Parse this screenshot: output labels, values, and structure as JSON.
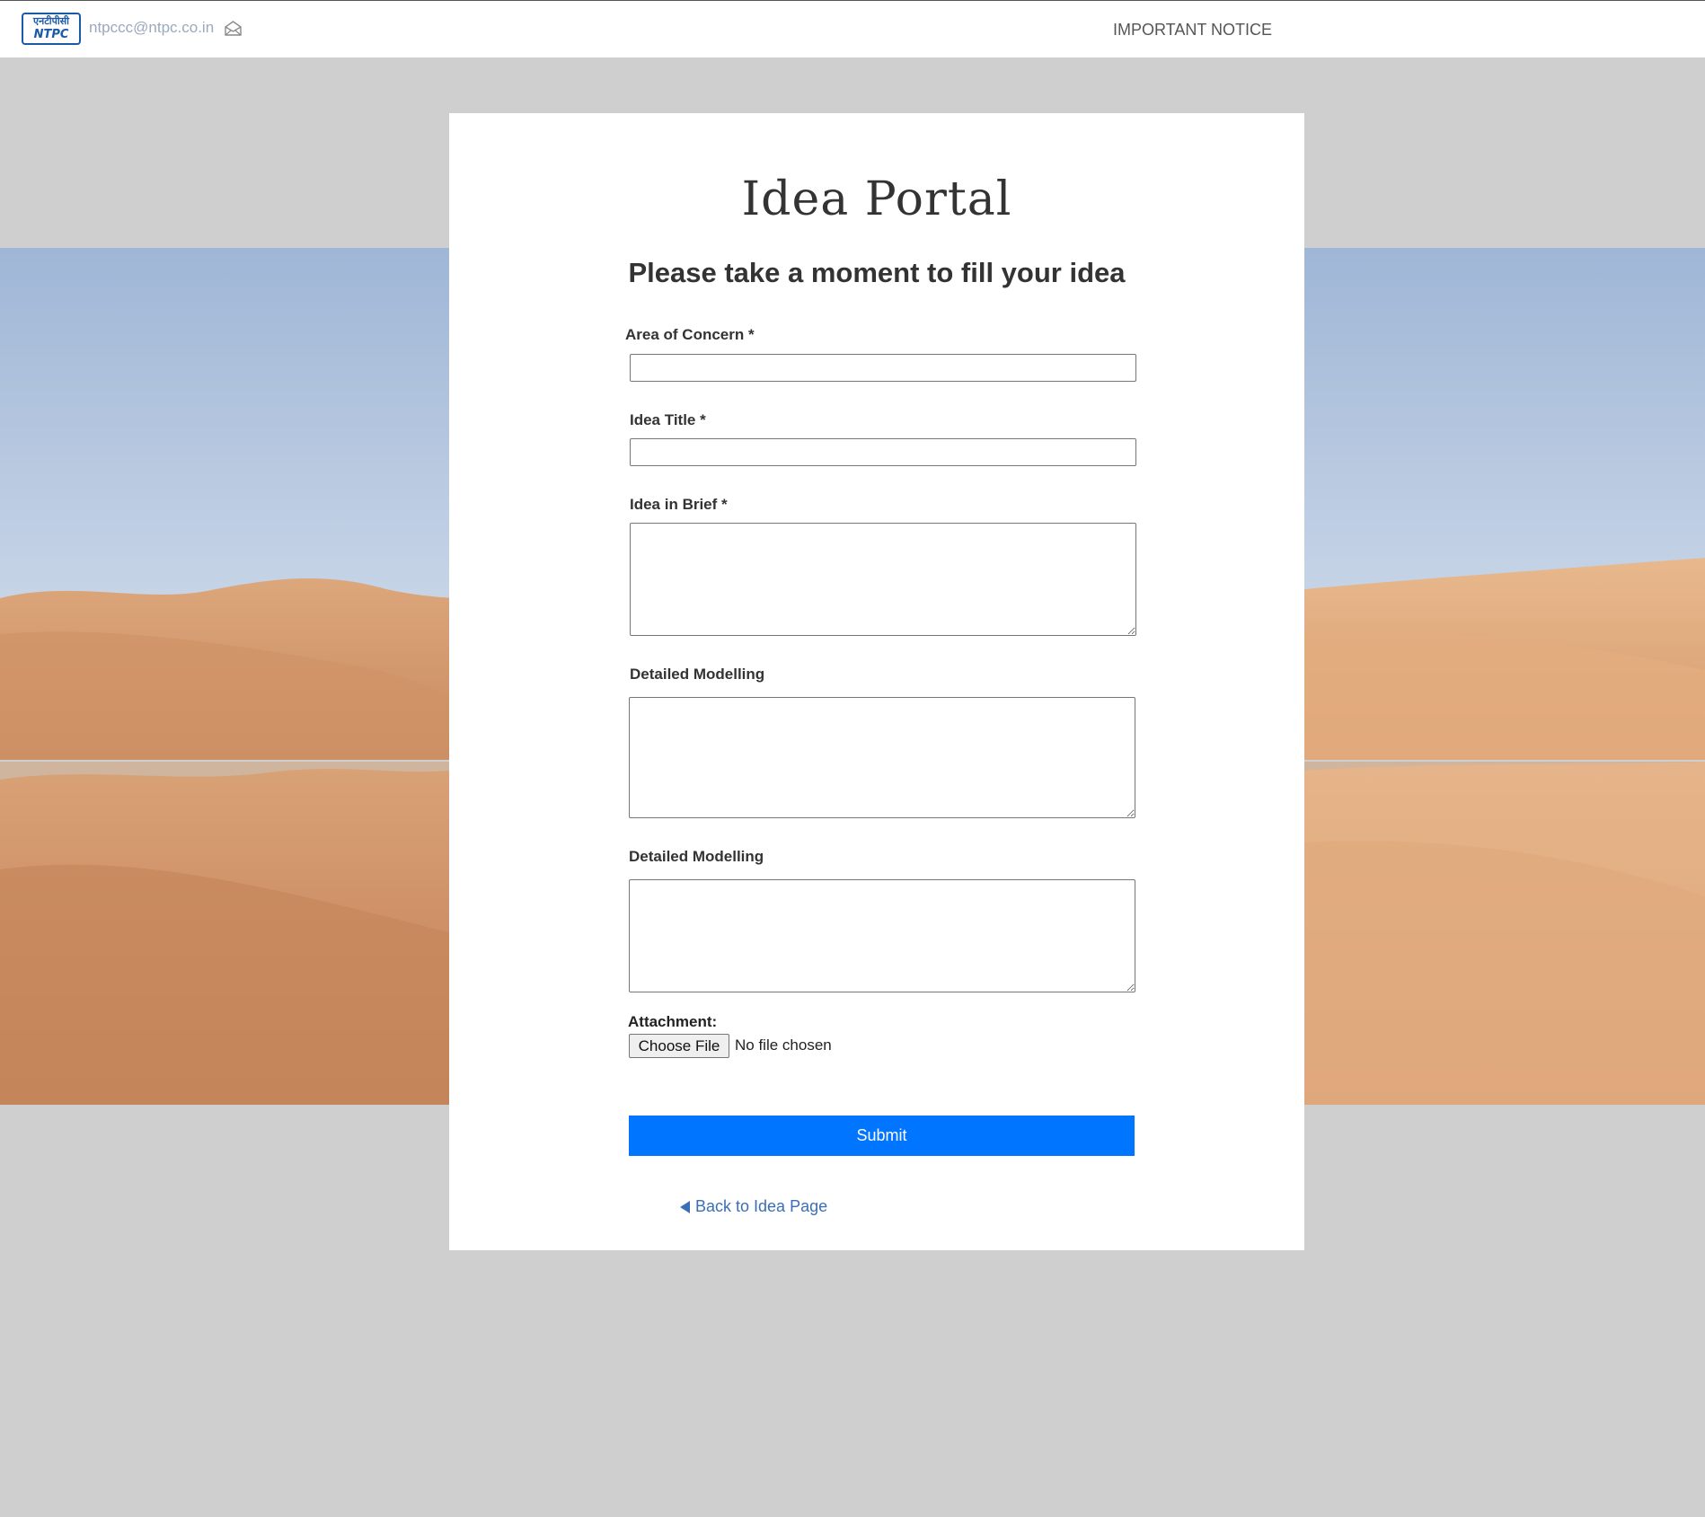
{
  "header": {
    "logo_hindi": "एनटीपीसी",
    "logo_text": "NTPC",
    "email": "ntpccc@ntpc.co.in",
    "notice_link": "IMPORTANT NOTICE"
  },
  "form": {
    "title": "Idea Portal",
    "subtitle": "Please take a moment to fill your idea",
    "fields": [
      {
        "label": "Area of Concern *",
        "value": ""
      },
      {
        "label": "Idea Title *",
        "value": ""
      },
      {
        "label": "Idea in Brief *",
        "value": ""
      },
      {
        "label": "Detailed Modelling",
        "value": ""
      },
      {
        "label": "Detailed Modelling",
        "value": ""
      }
    ],
    "attachment": {
      "label": "Attachment:",
      "button_label": "Choose File",
      "status": "No file chosen"
    },
    "submit_label": "Submit",
    "back_label": "Back to Idea Page"
  },
  "colors": {
    "page_background": "#cfcfcf",
    "submit": "#0075ff",
    "link": "#3b6fb5"
  }
}
